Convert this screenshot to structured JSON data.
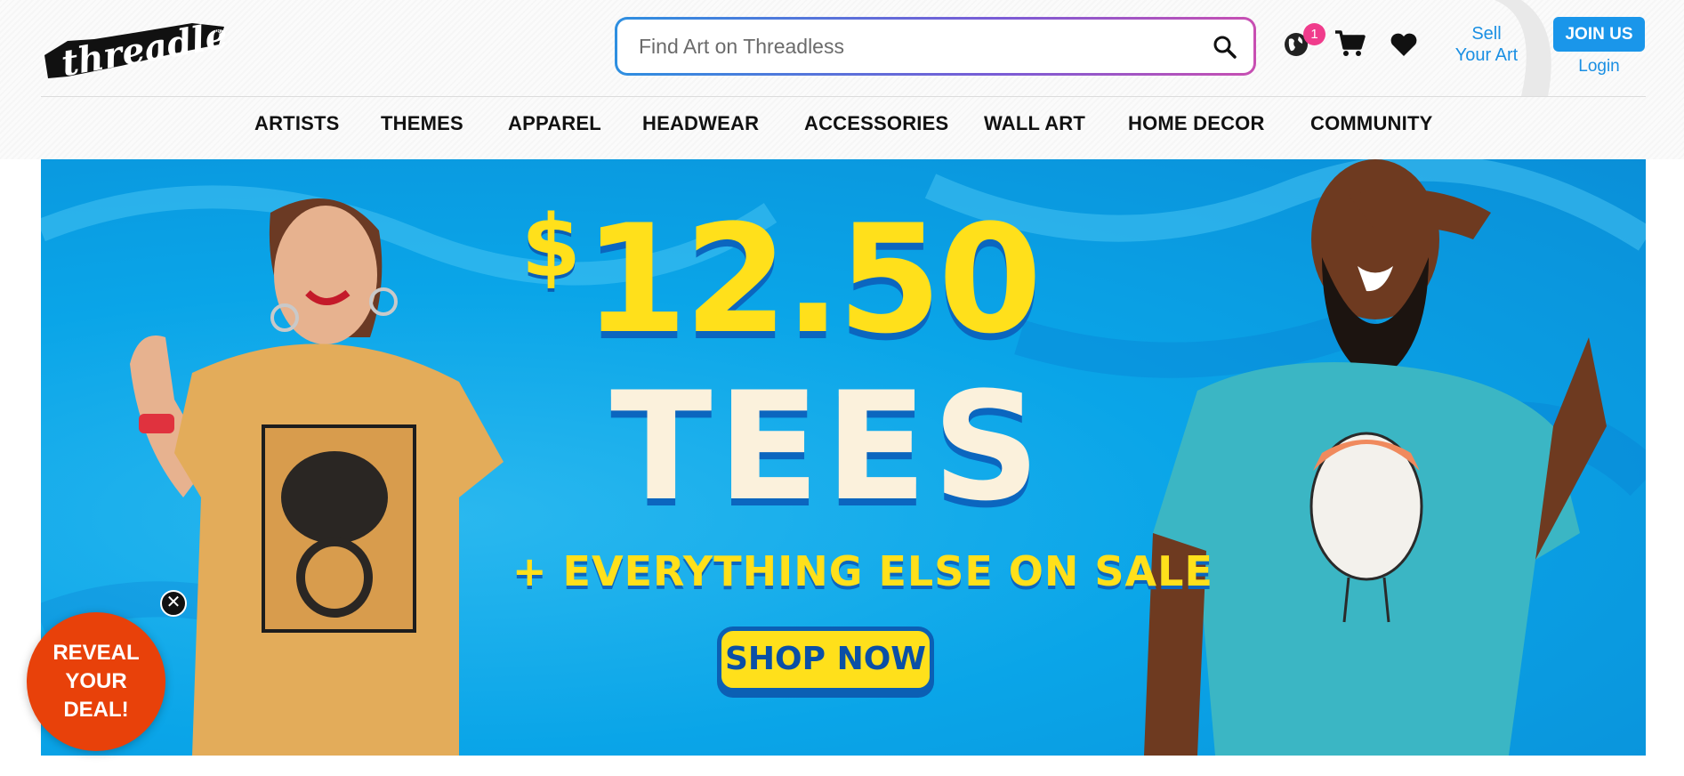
{
  "header": {
    "logo_text": "threadless",
    "search": {
      "placeholder": "Find Art on Threadless"
    },
    "cart_badge": "1",
    "sell_link": {
      "line1": "Sell",
      "line2": "Your Art"
    },
    "join_label": "JOIN US",
    "login_label": "Login"
  },
  "nav": {
    "items": [
      "ARTISTS",
      "THEMES",
      "APPAREL",
      "HEADWEAR",
      "ACCESSORIES",
      "WALL ART",
      "HOME DECOR",
      "COMMUNITY"
    ]
  },
  "hero": {
    "dollar": "$",
    "price": "12.50",
    "product": "TEES",
    "subline": "+ EVERYTHING ELSE ON SALE",
    "cta": "SHOP NOW"
  },
  "popup": {
    "close_glyph": "✕",
    "reveal_lines": [
      "REVEAL",
      "YOUR",
      "DEAL!"
    ]
  },
  "colors": {
    "accent": "#1a96ea",
    "badge": "#f03c8c",
    "hero_bg": "#0aa5e8",
    "hero_yellow": "#ffe01b",
    "reveal": "#e8410a"
  }
}
